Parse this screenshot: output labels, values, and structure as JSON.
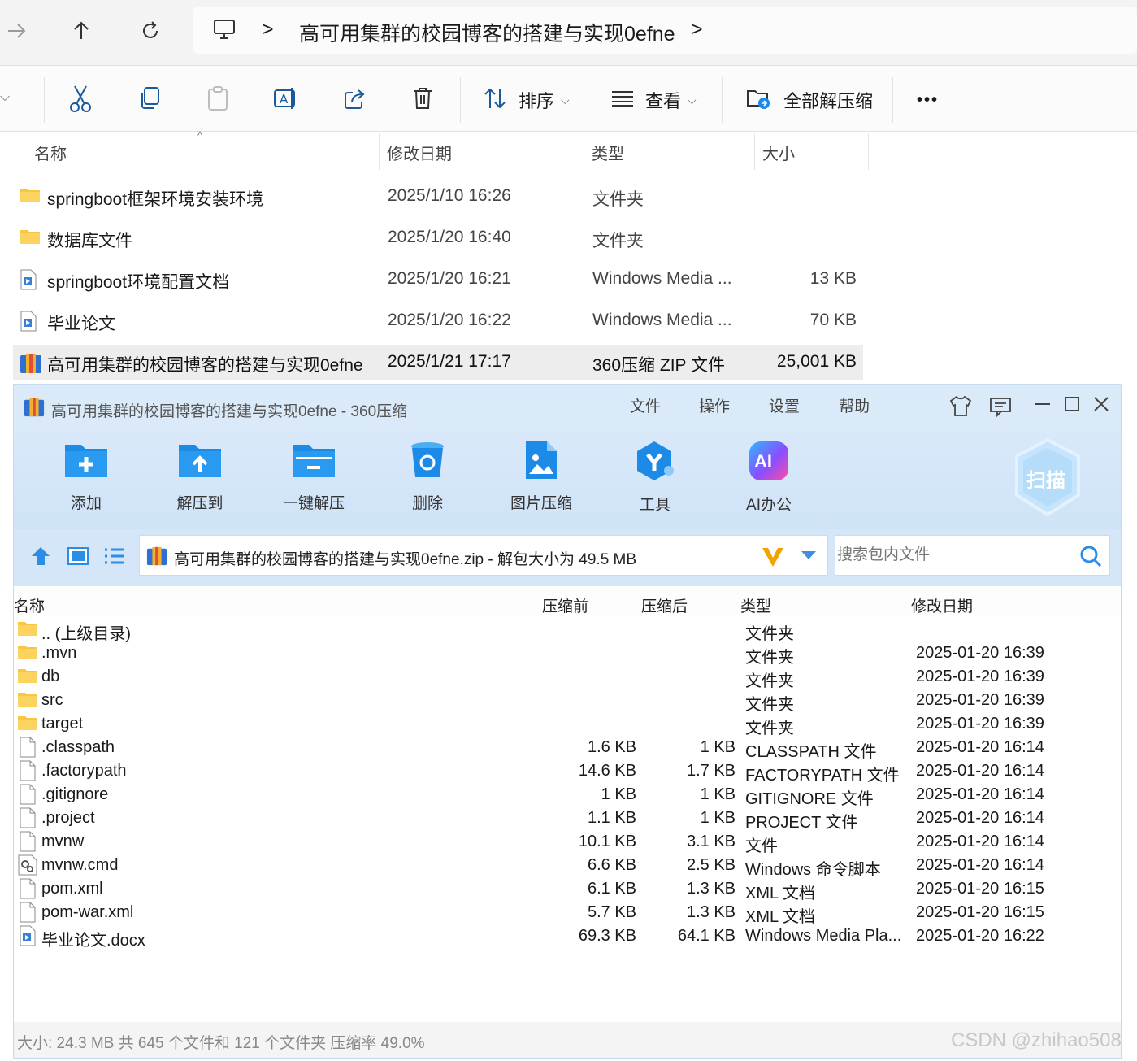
{
  "explorer": {
    "nav": {
      "forward_icon": "arrow-right-icon",
      "up_icon": "arrow-up-icon",
      "refresh_icon": "refresh-icon"
    },
    "breadcrumb": {
      "separator": ">",
      "current": "高可用集群的校园博客的搭建与实现0efne"
    },
    "toolbar": {
      "sort_label": "排序",
      "view_label": "查看",
      "extract_all_label": "全部解压缩",
      "more_label": "•••"
    },
    "columns": {
      "name": "名称",
      "modified": "修改日期",
      "type": "类型",
      "size": "大小"
    },
    "files": [
      {
        "name": "springboot框架环境安装环境",
        "modified": "2025/1/10 16:26",
        "type": "文件夹",
        "size": "",
        "icon": "folder-icon"
      },
      {
        "name": "数据库文件",
        "modified": "2025/1/20 16:40",
        "type": "文件夹",
        "size": "",
        "icon": "folder-icon"
      },
      {
        "name": "springboot环境配置文档",
        "modified": "2025/1/20 16:21",
        "type": "Windows Media ...",
        "size": "13 KB",
        "icon": "media-file-icon"
      },
      {
        "name": "毕业论文",
        "modified": "2025/1/20 16:22",
        "type": "Windows Media ...",
        "size": "70 KB",
        "icon": "media-file-icon"
      },
      {
        "name": "高可用集群的校园博客的搭建与实现0efne",
        "modified": "2025/1/21 17:17",
        "type": "360压缩 ZIP 文件",
        "size": "25,001 KB",
        "icon": "zip-archive-icon",
        "selected": true
      }
    ]
  },
  "win360": {
    "title": "高可用集群的校园博客的搭建与实现0efne - 360压缩",
    "menu": [
      "文件",
      "操作",
      "设置",
      "帮助"
    ],
    "ribbon": [
      {
        "label": "添加",
        "icon": "add-folder-icon"
      },
      {
        "label": "解压到",
        "icon": "extract-to-icon"
      },
      {
        "label": "一键解压",
        "icon": "one-click-extract-icon"
      },
      {
        "label": "删除",
        "icon": "delete-bin-icon"
      },
      {
        "label": "图片压缩",
        "icon": "image-compress-icon"
      },
      {
        "label": "工具",
        "icon": "tools-icon"
      },
      {
        "label": "AI办公",
        "icon": "ai-office-icon"
      }
    ],
    "scan_label": "扫描",
    "ai_badge": "AI",
    "path_text": "高可用集群的校园博客的搭建与实现0efne.zip - 解包大小为 49.5 MB",
    "search_placeholder": "搜索包内文件",
    "columns": {
      "name": "名称",
      "before": "压缩前",
      "after": "压缩后",
      "type": "类型",
      "modified": "修改日期"
    },
    "rows": [
      {
        "name": ".. (上级目录)",
        "before": "",
        "after": "",
        "type": "文件夹",
        "modified": "",
        "icon": "folder-icon"
      },
      {
        "name": ".mvn",
        "before": "",
        "after": "",
        "type": "文件夹",
        "modified": "2025-01-20 16:39",
        "icon": "folder-icon"
      },
      {
        "name": "db",
        "before": "",
        "after": "",
        "type": "文件夹",
        "modified": "2025-01-20 16:39",
        "icon": "folder-icon"
      },
      {
        "name": "src",
        "before": "",
        "after": "",
        "type": "文件夹",
        "modified": "2025-01-20 16:39",
        "icon": "folder-icon"
      },
      {
        "name": "target",
        "before": "",
        "after": "",
        "type": "文件夹",
        "modified": "2025-01-20 16:39",
        "icon": "folder-icon"
      },
      {
        "name": ".classpath",
        "before": "1.6 KB",
        "after": "1 KB",
        "type": "CLASSPATH 文件",
        "modified": "2025-01-20 16:14",
        "icon": "file-icon"
      },
      {
        "name": ".factorypath",
        "before": "14.6 KB",
        "after": "1.7 KB",
        "type": "FACTORYPATH 文件",
        "modified": "2025-01-20 16:14",
        "icon": "file-icon"
      },
      {
        "name": ".gitignore",
        "before": "1 KB",
        "after": "1 KB",
        "type": "GITIGNORE 文件",
        "modified": "2025-01-20 16:14",
        "icon": "file-icon"
      },
      {
        "name": ".project",
        "before": "1.1 KB",
        "after": "1 KB",
        "type": "PROJECT 文件",
        "modified": "2025-01-20 16:14",
        "icon": "file-icon"
      },
      {
        "name": "mvnw",
        "before": "10.1 KB",
        "after": "3.1 KB",
        "type": "文件",
        "modified": "2025-01-20 16:14",
        "icon": "file-icon"
      },
      {
        "name": "mvnw.cmd",
        "before": "6.6 KB",
        "after": "2.5 KB",
        "type": "Windows 命令脚本",
        "modified": "2025-01-20 16:14",
        "icon": "cmd-script-icon"
      },
      {
        "name": "pom.xml",
        "before": "6.1 KB",
        "after": "1.3 KB",
        "type": "XML 文档",
        "modified": "2025-01-20 16:15",
        "icon": "file-icon"
      },
      {
        "name": "pom-war.xml",
        "before": "5.7 KB",
        "after": "1.3 KB",
        "type": "XML 文档",
        "modified": "2025-01-20 16:15",
        "icon": "file-icon"
      },
      {
        "name": "毕业论文.docx",
        "before": "69.3 KB",
        "after": "64.1 KB",
        "type": "Windows Media Pla...",
        "modified": "2025-01-20 16:22",
        "icon": "media-file-icon"
      }
    ],
    "status": "大小: 24.3 MB 共 645 个文件和 121 个文件夹 压缩率 49.0%"
  },
  "watermark": "CSDN @zhihao508",
  "colors": {
    "folder": "#f8c640",
    "accent_blue": "#1e8ae8",
    "ai_purple": "#8a4dff",
    "selected_row": "#ededed"
  }
}
